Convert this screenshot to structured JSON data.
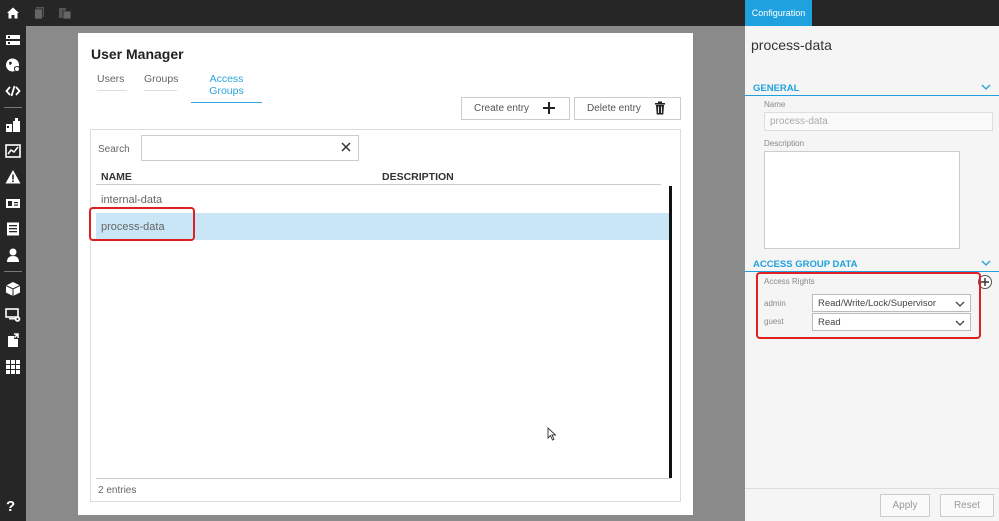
{
  "colors": {
    "accent": "#1fa1e0",
    "highlight": "#e02020",
    "selected_row": "#c8e6f5"
  },
  "topbar": {
    "icons": [
      "home-icon",
      "copy-icon",
      "paste-icon"
    ]
  },
  "sidebar": {
    "icons": [
      "list-icon",
      "globe-icon",
      "code-icon",
      "modules-icon",
      "chart-icon",
      "warning-icon",
      "id-card-icon",
      "log-icon",
      "user-icon",
      "package-icon",
      "monitor-settings-icon",
      "export-icon",
      "grid-icon"
    ],
    "help": "?"
  },
  "card": {
    "title": "User Manager",
    "tabs": [
      {
        "label": "Users",
        "active": false
      },
      {
        "label": "Groups",
        "active": false
      },
      {
        "label": "Access Groups",
        "active": true
      }
    ],
    "create_label": "Create entry",
    "delete_label": "Delete entry",
    "search": {
      "label": "Search",
      "value": "",
      "placeholder": ""
    },
    "columns": [
      "NAME",
      "DESCRIPTION"
    ],
    "rows": [
      {
        "name": "internal-data",
        "description": "",
        "selected": false
      },
      {
        "name": "process-data",
        "description": "",
        "selected": true
      }
    ],
    "entries": "2 entries"
  },
  "panel": {
    "tab": "Configuration",
    "title": "process-data",
    "general": {
      "section": "GENERAL",
      "name_label": "Name",
      "name_value": "process-data",
      "description_label": "Description",
      "description_value": ""
    },
    "access": {
      "section": "ACCESS GROUP DATA",
      "rights_label": "Access Rights",
      "rights": [
        {
          "group": "admin",
          "value": "Read/Write/Lock/Supervisor"
        },
        {
          "group": "guest",
          "value": "Read"
        }
      ]
    },
    "apply_label": "Apply",
    "reset_label": "Reset"
  }
}
